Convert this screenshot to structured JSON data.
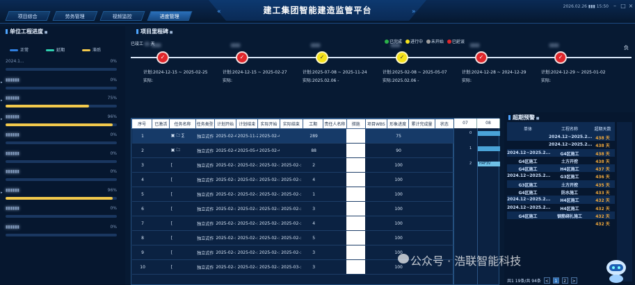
{
  "header": {
    "title": "建工集团智能建造监管平台",
    "tabs": [
      {
        "label": "项目综合",
        "active": false
      },
      {
        "label": "劳务管理",
        "active": false
      },
      {
        "label": "视频监控",
        "active": false
      },
      {
        "label": "进度管理",
        "active": true
      }
    ],
    "datetime": "2026.02.26 ▮▮▮ 15:50"
  },
  "left_panel": {
    "title": "单位工程进度",
    "legend": [
      {
        "label": "正常",
        "color": "#2f7fe0"
      },
      {
        "label": "延期",
        "color": "#2fd0b0"
      },
      {
        "label": "滞后",
        "color": "#f2c94c"
      }
    ],
    "items": [
      {
        "name": "2024.1...",
        "percent": "0%",
        "value": 0
      },
      {
        "name": "",
        "percent": "0%",
        "value": 0
      },
      {
        "name": "",
        "percent": "75%",
        "value": 75
      },
      {
        "name": "",
        "percent": "96%",
        "value": 96
      },
      {
        "name": "",
        "percent": "0%",
        "value": 0
      },
      {
        "name": "",
        "percent": "0%",
        "value": 0
      },
      {
        "name": "",
        "percent": "0%",
        "value": 0
      },
      {
        "name": "",
        "percent": "96%",
        "value": 96
      },
      {
        "name": "",
        "percent": "0%",
        "value": 0
      },
      {
        "name": "",
        "percent": "0%",
        "value": 0
      }
    ]
  },
  "timeline": {
    "title": "项目里程碑",
    "label_left": "已竣工",
    "label_left_suffix": "天",
    "label_right": "负",
    "status_legend": [
      {
        "label": "已完成",
        "color": "#2bb34a"
      },
      {
        "label": "进行中",
        "color": "#f5e21c"
      },
      {
        "label": "未开始",
        "color": "#a0a0a0"
      },
      {
        "label": "已延误",
        "color": "#e0262b"
      }
    ],
    "nodes": [
      {
        "status": "red",
        "plan": "计划:2024-12-15 ~ 2025-02-25",
        "actual": "实际:"
      },
      {
        "status": "red",
        "plan": "计划:2024-12-15 ~ 2025-02-27",
        "actual": "实际:"
      },
      {
        "status": "yellow",
        "plan": "计划:2025-07-08 ~ 2025-11-24",
        "actual": "实际:2025.02.06 -"
      },
      {
        "status": "yellow",
        "plan": "计划:2025-02-08 ~ 2025-05-07",
        "actual": "实际:2025.02.06 -"
      },
      {
        "status": "red",
        "plan": "计划:2024-12-28 ~ 2024-12-29",
        "actual": "实际:"
      },
      {
        "status": "red",
        "plan": "计划:2024-12-29 ~ 2025-01-02",
        "actual": "实际:"
      }
    ]
  },
  "task_table": {
    "headers": [
      "序号",
      "已激活",
      "任务名称",
      "任务类型",
      "计划开始",
      "计划结束",
      "实际开始",
      "实际结束",
      "工期",
      "责任人名称",
      "措施",
      "项目WBS",
      "形象进度",
      "累计完成量",
      "状态"
    ],
    "rows": [
      {
        "no": "1",
        "name": "▣ 🗀 ∑",
        "type": "独立式作",
        "plan_start": "2025-02-4",
        "plan_end": "2025-11-2",
        "act_start": "2025-02-4",
        "act_end": "",
        "duration": "289",
        "progress": "75"
      },
      {
        "no": "2",
        "name": "▣ 🗀",
        "type": "独立式作",
        "plan_start": "2025-02-4",
        "plan_end": "2025-05-4",
        "act_start": "2025-02-4",
        "act_end": "",
        "duration": "88",
        "progress": "90"
      },
      {
        "no": "3",
        "name": "[",
        "type": "独立式作",
        "plan_start": "2025-02-:",
        "plan_end": "2025-02-:",
        "act_start": "2025-02-:",
        "act_end": "2025-02-:",
        "duration": "2",
        "progress": "100"
      },
      {
        "no": "4",
        "name": "[",
        "type": "独立式作",
        "plan_start": "2025-02-:",
        "plan_end": "2025-02-:",
        "act_start": "2025-02-:",
        "act_end": "2025-02-:",
        "duration": "4",
        "progress": "100"
      },
      {
        "no": "5",
        "name": "[",
        "type": "独立式作",
        "plan_start": "2025-02-:",
        "plan_end": "2025-02-:",
        "act_start": "2025-02-:",
        "act_end": "2025-02-:",
        "duration": "1",
        "progress": "100"
      },
      {
        "no": "6",
        "name": "[",
        "type": "独立式作",
        "plan_start": "2025-02-:",
        "plan_end": "2025-02-:",
        "act_start": "2025-02-:",
        "act_end": "2025-02-:",
        "duration": "3",
        "progress": "100"
      },
      {
        "no": "7",
        "name": "[",
        "type": "独立式作",
        "plan_start": "2025-02-:",
        "plan_end": "2025-02-:",
        "act_start": "2025-02-:",
        "act_end": "2025-02-:",
        "duration": "4",
        "progress": "100"
      },
      {
        "no": "8",
        "name": "[",
        "type": "独立式作",
        "plan_start": "2025-02-:",
        "plan_end": "2025-02-:",
        "act_start": "2025-02-:",
        "act_end": "2025-02-:",
        "duration": "5",
        "progress": "100"
      },
      {
        "no": "9",
        "name": "[",
        "type": "独立式作",
        "plan_start": "2025-02-:",
        "plan_end": "2025-02-:",
        "act_start": "2025-02-:",
        "act_end": "2025-02-:",
        "duration": "3",
        "progress": "100"
      },
      {
        "no": "10",
        "name": "[",
        "type": "独立式作",
        "plan_start": "2025-02-:",
        "plan_end": "2025-02-:",
        "act_start": "2025-02-:",
        "act_end": "2025-03-:",
        "duration": "3",
        "progress": "100"
      }
    ]
  },
  "gantt": {
    "headers": [
      "07",
      "08"
    ],
    "labels": [
      "0",
      "1",
      "2"
    ],
    "bar_label": "H4F3V"
  },
  "right_panel": {
    "title": "超期预警",
    "headers": [
      "单体",
      "工程名称",
      "超期天数"
    ],
    "rows": [
      {
        "unit": "",
        "name": "2024.12~2025.2...",
        "days": "438 天"
      },
      {
        "unit": "",
        "name": "2024.12~2025.2...",
        "days": "438 天"
      },
      {
        "unit": "2024.12~2025.2...",
        "name": "G4区施工",
        "days": "438 天"
      },
      {
        "unit": "G4区施工",
        "name": "土方开挖",
        "days": "438 天"
      },
      {
        "unit": "G4区施工",
        "name": "H4区施工",
        "days": "437 天"
      },
      {
        "unit": "2024.12~2025.2...",
        "name": "G3区施工",
        "days": "436 天"
      },
      {
        "unit": "G3区施工",
        "name": "土方开挖",
        "days": "435 天"
      },
      {
        "unit": "G4区施工",
        "name": "防水施工",
        "days": "433 天"
      },
      {
        "unit": "2024.12~2025.2...",
        "name": "H4区施工",
        "days": "432 天"
      },
      {
        "unit": "2024.12~2025.2...",
        "name": "H4区施工",
        "days": "432 天"
      },
      {
        "unit": "G4区施工",
        "name": "钢筋绑扎施工",
        "days": "432 天"
      },
      {
        "unit": "",
        "name": "",
        "days": "432 天"
      }
    ],
    "pager_text": "共1 19条/共 94条",
    "pages": [
      "<",
      "1",
      "2",
      ">"
    ]
  },
  "watermark": "公众号 · 浩联智能科技"
}
